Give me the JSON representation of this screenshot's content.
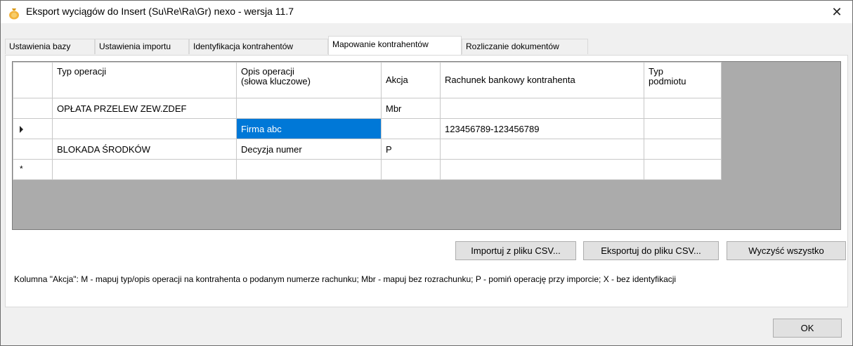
{
  "window": {
    "title": "Eksport wyciągów do Insert (Su\\Re\\Ra\\Gr) nexo - wersja 11.7",
    "close_glyph": "✕"
  },
  "tabs": [
    {
      "label": "Ustawienia bazy",
      "active": false
    },
    {
      "label": "Ustawienia importu",
      "active": false
    },
    {
      "label": "Identyfikacja kontrahentów",
      "active": false
    },
    {
      "label": "Mapowanie kontrahentów",
      "active": true
    },
    {
      "label": "Rozliczanie dokumentów",
      "active": false
    }
  ],
  "grid": {
    "columns": {
      "typ_operacji": "Typ operacji",
      "opis_operacji_1": "Opis operacji",
      "opis_operacji_2": "(słowa kluczowe)",
      "akcja": "Akcja",
      "rachunek": "Rachunek bankowy kontrahenta",
      "typ_podmiotu_1": "Typ",
      "typ_podmiotu_2": "podmiotu"
    },
    "rows": [
      {
        "typ": "OPŁATA PRZELEW ZEW.ZDEF",
        "opis": "",
        "akcja": "Mbr",
        "rachunek": "",
        "podmiot": ""
      },
      {
        "typ": "",
        "opis": "Firma abc",
        "akcja": "",
        "rachunek": "123456789-123456789",
        "podmiot": ""
      },
      {
        "typ": "BLOKADA ŚRODKÓW",
        "opis": "Decyzja numer",
        "akcja": "P",
        "rachunek": "",
        "podmiot": ""
      },
      {
        "typ": "",
        "opis": "",
        "akcja": "",
        "rachunek": "",
        "podmiot": ""
      }
    ],
    "new_row_glyph": "*"
  },
  "buttons": {
    "import_csv": "Importuj z pliku CSV...",
    "export_csv": "Eksportuj do pliku CSV...",
    "clear_all": "Wyczyść wszystko",
    "ok": "OK"
  },
  "info": "Kolumna \"Akcja\": M - mapuj typ/opis operacji na kontrahenta o podanym numerze rachunku; Mbr - mapuj bez rozrachunku; P - pomiń operację przy imporcie; X - bez identyfikacji",
  "colors": {
    "selection": "#0078d7",
    "grid_empty_area": "#ababab"
  }
}
